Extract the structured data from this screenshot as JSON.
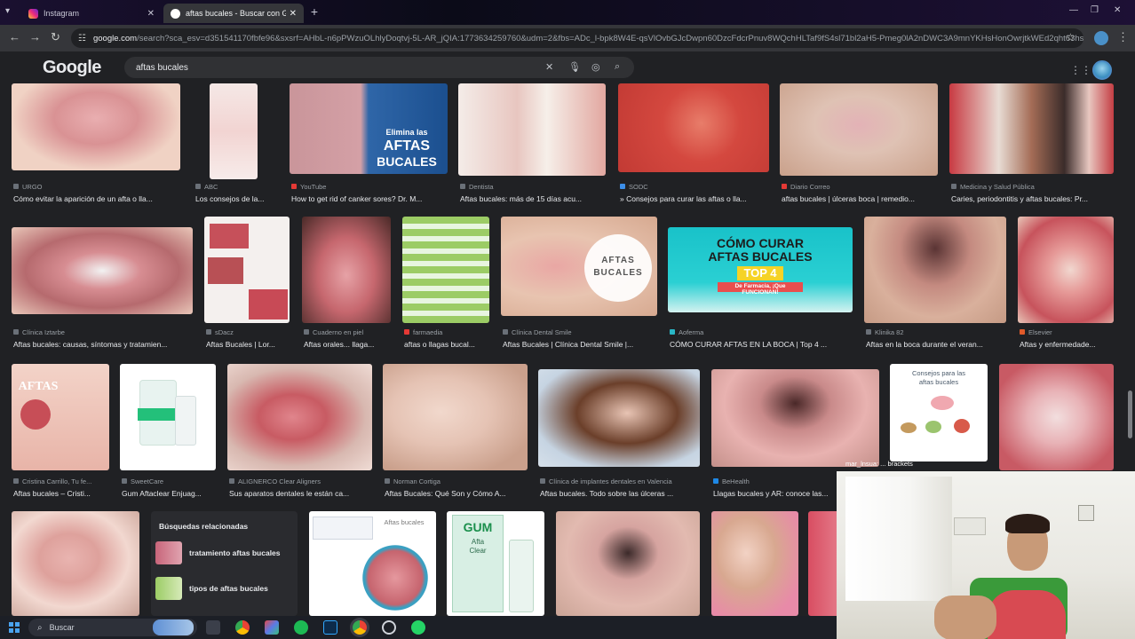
{
  "browser": {
    "tabs": [
      {
        "title": "Instagram",
        "active": false
      },
      {
        "title": "aftas bucales - Buscar con Goo",
        "active": true
      }
    ],
    "url_host": "google.com",
    "url_path": "/search?sca_esv=d351541170fbfe96&sxsrf=AHbL-n6pPWzuOLhlyDoqtvj-5L-AR_jQIA:1773634259760&udm=2&fbs=ADc_l-bpk8W4E-qsVlOvbGJcDwpn60DzcFdcrPnuv8WQchHLTaf9fS4sl71bl2aH5-Pmeg0lA2nDWC3A9mnYKHsHonOwrjtkWEd2qht63hsp..."
  },
  "google": {
    "logo": "Google",
    "query": "aftas bucales"
  },
  "row1": [
    {
      "source": "URGO",
      "title": "Cómo evitar la aparición de un afta o lla..."
    },
    {
      "source": "ABC",
      "title": "Los consejos de la..."
    },
    {
      "source": "YouTube",
      "title": "How to get rid of canker sores? Dr. M...",
      "overlay": [
        "Elimina las",
        "AFTAS",
        "BUCALES"
      ]
    },
    {
      "source": "Dentista",
      "title": "Aftas bucales: más de 15 días acu..."
    },
    {
      "source": "SODC",
      "title": "» Consejos para curar las aftas o lla..."
    },
    {
      "source": "Diario Correo",
      "title": "aftas bucales | úlceras boca | remedio..."
    },
    {
      "source": "Medicina y Salud Pública",
      "title": "Caries, periodontitis y aftas bucales: Pr..."
    }
  ],
  "row2": [
    {
      "source": "Clínica Iztarbe",
      "title": "Aftas bucales: causas, síntomas y tratamien..."
    },
    {
      "source": "sDacz",
      "title": "Aftas Bucales | Lor..."
    },
    {
      "source": "Cuaderno en piel",
      "title": "Aftas orales... llaga..."
    },
    {
      "source": "farmaedia",
      "title": "aftas o llagas bucal..."
    },
    {
      "source": "Clínica Dental Smile",
      "title": "Aftas Bucales | Clínica Dental Smile |...",
      "overlay": [
        "AFTAS",
        "BUCALES"
      ]
    },
    {
      "source": "Aoferma",
      "title": "CÓMO CURAR AFTAS EN LA BOCA | Top 4 ...",
      "overlay": [
        "CÓMO CURAR",
        "AFTAS BUCALES",
        "TOP 4",
        "De Farmacia, ¡Que FUNCIONAN!"
      ]
    },
    {
      "source": "Klinika 82",
      "title": "Aftas en la boca durante el veran..."
    },
    {
      "source": "Elsevier",
      "title": "Aftas y enfermedade..."
    }
  ],
  "row3": [
    {
      "source": "Cristina Carrillo, Tu fe...",
      "title": "Aftas bucales – Cristi...",
      "overlay": [
        "AFTAS"
      ]
    },
    {
      "source": "SweetCare",
      "title": "Gum Aftaclear Enjuag..."
    },
    {
      "source": "ALIGNERCO Clear Aligners",
      "title": "Sus aparatos dentales le están ca..."
    },
    {
      "source": "Norman Cortiga",
      "title": "Aftas Bucales: Qué Son y Cómo A..."
    },
    {
      "source": "Clínica de implantes dentales en Valencia",
      "title": "Aftas bucales. Todo sobre las úlceras ..."
    },
    {
      "source": "BeHealth",
      "title": "Llagas bucales y AR: conoce las..."
    },
    {
      "source": "",
      "title": "",
      "overlay": [
        "Consejos para las",
        "aftas bucales"
      ]
    },
    {
      "source": "",
      "title": ""
    }
  ],
  "row4": [
    {
      "overlay": [
        "Aftas bucales"
      ]
    },
    {
      "overlay": [
        "GUM",
        "Afta",
        "Clear"
      ]
    },
    {},
    {},
    {}
  ],
  "related": {
    "heading": "Búsquedas relacionadas",
    "items": [
      "tratamiento aftas bucales",
      "tipos de aftas bucales"
    ]
  },
  "chat_overlay": "mar_lnsua: ... brackets",
  "taskbar": {
    "search_placeholder": "Buscar"
  }
}
